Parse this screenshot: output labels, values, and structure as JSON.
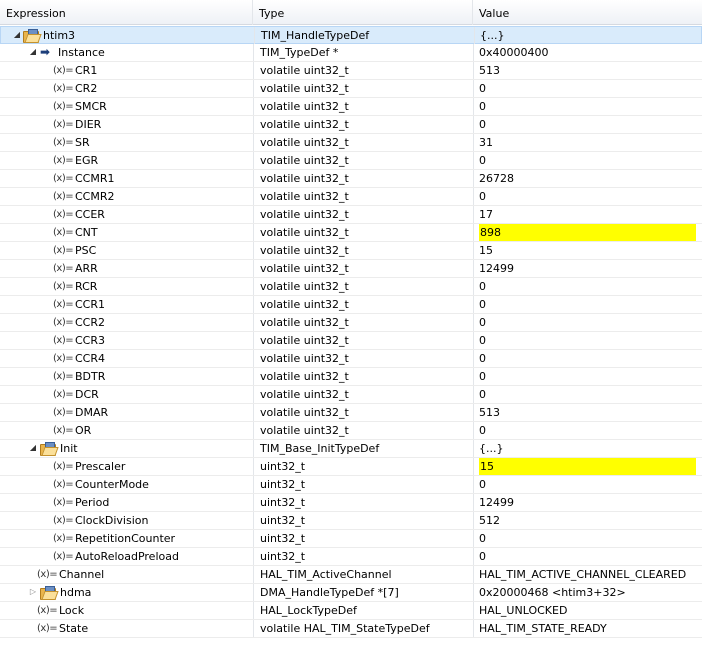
{
  "columns": {
    "expression": "Expression",
    "type": "Type",
    "value": "Value"
  },
  "var_icon_label": "(x)=",
  "rows": [
    {
      "name": "htim3",
      "type": "TIM_HandleTypeDef",
      "value": "{...}",
      "level": 0,
      "icon": "struct-folder-icon",
      "expander": "expanded",
      "selected": true
    },
    {
      "name": "Instance",
      "type": "TIM_TypeDef *",
      "value": "0x40000400",
      "level": 1,
      "icon": "pointer-arrow-icon",
      "expander": "expanded"
    },
    {
      "name": "CR1",
      "type": "volatile uint32_t",
      "value": "513",
      "level": 2,
      "icon": "variable-icon"
    },
    {
      "name": "CR2",
      "type": "volatile uint32_t",
      "value": "0",
      "level": 2,
      "icon": "variable-icon"
    },
    {
      "name": "SMCR",
      "type": "volatile uint32_t",
      "value": "0",
      "level": 2,
      "icon": "variable-icon"
    },
    {
      "name": "DIER",
      "type": "volatile uint32_t",
      "value": "0",
      "level": 2,
      "icon": "variable-icon"
    },
    {
      "name": "SR",
      "type": "volatile uint32_t",
      "value": "31",
      "level": 2,
      "icon": "variable-icon"
    },
    {
      "name": "EGR",
      "type": "volatile uint32_t",
      "value": "0",
      "level": 2,
      "icon": "variable-icon"
    },
    {
      "name": "CCMR1",
      "type": "volatile uint32_t",
      "value": "26728",
      "level": 2,
      "icon": "variable-icon"
    },
    {
      "name": "CCMR2",
      "type": "volatile uint32_t",
      "value": "0",
      "level": 2,
      "icon": "variable-icon"
    },
    {
      "name": "CCER",
      "type": "volatile uint32_t",
      "value": "17",
      "level": 2,
      "icon": "variable-icon"
    },
    {
      "name": "CNT",
      "type": "volatile uint32_t",
      "value": "898",
      "level": 2,
      "icon": "variable-icon",
      "changed": true
    },
    {
      "name": "PSC",
      "type": "volatile uint32_t",
      "value": "15",
      "level": 2,
      "icon": "variable-icon"
    },
    {
      "name": "ARR",
      "type": "volatile uint32_t",
      "value": "12499",
      "level": 2,
      "icon": "variable-icon"
    },
    {
      "name": "RCR",
      "type": "volatile uint32_t",
      "value": "0",
      "level": 2,
      "icon": "variable-icon"
    },
    {
      "name": "CCR1",
      "type": "volatile uint32_t",
      "value": "0",
      "level": 2,
      "icon": "variable-icon"
    },
    {
      "name": "CCR2",
      "type": "volatile uint32_t",
      "value": "0",
      "level": 2,
      "icon": "variable-icon"
    },
    {
      "name": "CCR3",
      "type": "volatile uint32_t",
      "value": "0",
      "level": 2,
      "icon": "variable-icon"
    },
    {
      "name": "CCR4",
      "type": "volatile uint32_t",
      "value": "0",
      "level": 2,
      "icon": "variable-icon"
    },
    {
      "name": "BDTR",
      "type": "volatile uint32_t",
      "value": "0",
      "level": 2,
      "icon": "variable-icon"
    },
    {
      "name": "DCR",
      "type": "volatile uint32_t",
      "value": "0",
      "level": 2,
      "icon": "variable-icon"
    },
    {
      "name": "DMAR",
      "type": "volatile uint32_t",
      "value": "513",
      "level": 2,
      "icon": "variable-icon"
    },
    {
      "name": "OR",
      "type": "volatile uint32_t",
      "value": "0",
      "level": 2,
      "icon": "variable-icon"
    },
    {
      "name": "Init",
      "type": "TIM_Base_InitTypeDef",
      "value": "{...}",
      "level": 1,
      "icon": "struct-folder-icon",
      "expander": "expanded"
    },
    {
      "name": "Prescaler",
      "type": "uint32_t",
      "value": "15",
      "level": 2,
      "icon": "variable-icon",
      "changed": true
    },
    {
      "name": "CounterMode",
      "type": "uint32_t",
      "value": "0",
      "level": 2,
      "icon": "variable-icon"
    },
    {
      "name": "Period",
      "type": "uint32_t",
      "value": "12499",
      "level": 2,
      "icon": "variable-icon"
    },
    {
      "name": "ClockDivision",
      "type": "uint32_t",
      "value": "512",
      "level": 2,
      "icon": "variable-icon"
    },
    {
      "name": "RepetitionCounter",
      "type": "uint32_t",
      "value": "0",
      "level": 2,
      "icon": "variable-icon"
    },
    {
      "name": "AutoReloadPreload",
      "type": "uint32_t",
      "value": "0",
      "level": 2,
      "icon": "variable-icon"
    },
    {
      "name": "Channel",
      "type": "HAL_TIM_ActiveChannel",
      "value": "HAL_TIM_ACTIVE_CHANNEL_CLEARED",
      "level": 1,
      "icon": "variable-icon"
    },
    {
      "name": "hdma",
      "type": "DMA_HandleTypeDef *[7]",
      "value": "0x20000468 <htim3+32>",
      "level": 1,
      "icon": "struct-folder-icon",
      "expander": "collapsed"
    },
    {
      "name": "Lock",
      "type": "HAL_LockTypeDef",
      "value": "HAL_UNLOCKED",
      "level": 1,
      "icon": "variable-icon"
    },
    {
      "name": "State",
      "type": "volatile HAL_TIM_StateTypeDef",
      "value": "HAL_TIM_STATE_READY",
      "level": 1,
      "icon": "variable-icon"
    }
  ]
}
